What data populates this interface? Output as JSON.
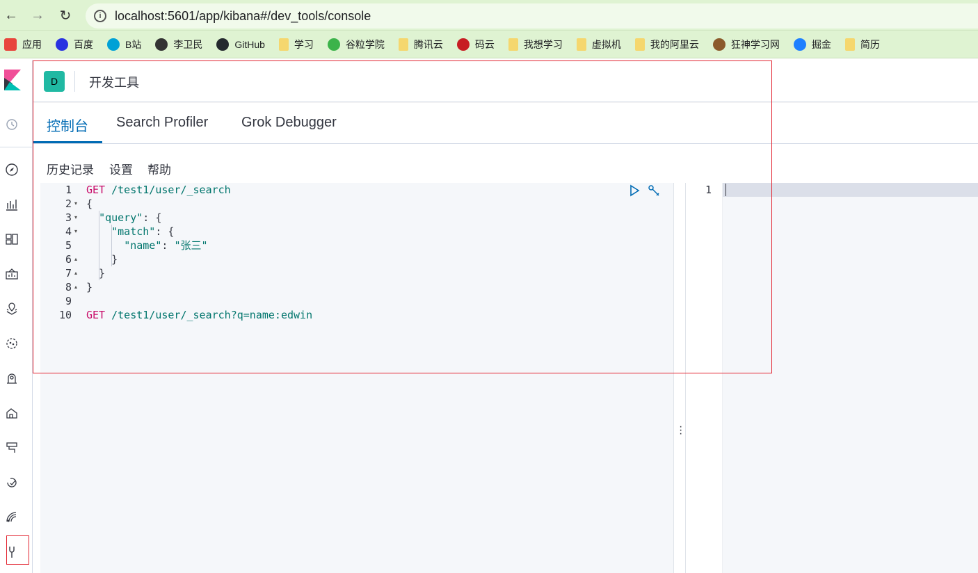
{
  "browser": {
    "url": "localhost:5601/app/kibana#/dev_tools/console",
    "bookmarks": [
      {
        "label": "应用",
        "icon": "apps-grid-icon",
        "color": "#e8453c"
      },
      {
        "label": "百度",
        "icon": "baidu-paw-icon",
        "color": "#2932e1"
      },
      {
        "label": "B站",
        "icon": "bilibili-tv-icon",
        "color": "#00a1d6"
      },
      {
        "label": "李卫民",
        "icon": "globe-icon",
        "color": "#333333"
      },
      {
        "label": "GitHub",
        "icon": "github-icon",
        "color": "#24292e"
      },
      {
        "label": "学习",
        "icon": "folder-icon",
        "color": "#f5d76e"
      },
      {
        "label": "谷粒学院",
        "icon": "gulixueyuan-icon",
        "color": "#3cb34a"
      },
      {
        "label": "腾讯云",
        "icon": "folder-icon",
        "color": "#f5d76e"
      },
      {
        "label": "码云",
        "icon": "gitee-icon",
        "color": "#c71d23"
      },
      {
        "label": "我想学习",
        "icon": "folder-icon",
        "color": "#f5d76e"
      },
      {
        "label": "虚拟机",
        "icon": "folder-icon",
        "color": "#f5d76e"
      },
      {
        "label": "我的阿里云",
        "icon": "folder-icon",
        "color": "#f5d76e"
      },
      {
        "label": "狂神学习网",
        "icon": "avatar-icon",
        "color": "#8b5a2b"
      },
      {
        "label": "掘金",
        "icon": "juejin-icon",
        "color": "#1e80ff"
      },
      {
        "label": "简历",
        "icon": "folder-icon",
        "color": "#f5d76e"
      }
    ]
  },
  "header": {
    "avatar_letter": "D",
    "title": "开发工具"
  },
  "tabs": [
    {
      "label": "控制台",
      "active": true
    },
    {
      "label": "Search Profiler",
      "active": false
    },
    {
      "label": "Grok Debugger",
      "active": false
    }
  ],
  "console_menu": {
    "history": "历史记录",
    "settings": "设置",
    "help": "帮助"
  },
  "editor": {
    "lines": [
      {
        "n": "1",
        "fold": "",
        "tokens": [
          [
            "kw",
            "GET"
          ],
          [
            "punc",
            " "
          ],
          [
            "path",
            "/test1/user/_search"
          ]
        ]
      },
      {
        "n": "2",
        "fold": "▾",
        "tokens": [
          [
            "punc",
            "{"
          ]
        ]
      },
      {
        "n": "3",
        "fold": "▾",
        "tokens": [
          [
            "punc",
            "  "
          ],
          [
            "key",
            "\"query\""
          ],
          [
            "punc",
            ": {"
          ]
        ]
      },
      {
        "n": "4",
        "fold": "▾",
        "tokens": [
          [
            "punc",
            "    "
          ],
          [
            "key",
            "\"match\""
          ],
          [
            "punc",
            ": {"
          ]
        ]
      },
      {
        "n": "5",
        "fold": "",
        "tokens": [
          [
            "punc",
            "      "
          ],
          [
            "key",
            "\"name\""
          ],
          [
            "punc",
            ": "
          ],
          [
            "str",
            "\"张三\""
          ]
        ]
      },
      {
        "n": "6",
        "fold": "▴",
        "tokens": [
          [
            "punc",
            "    }"
          ]
        ]
      },
      {
        "n": "7",
        "fold": "▴",
        "tokens": [
          [
            "punc",
            "  }"
          ]
        ]
      },
      {
        "n": "8",
        "fold": "▴",
        "tokens": [
          [
            "punc",
            "}"
          ]
        ]
      },
      {
        "n": "9",
        "fold": "",
        "tokens": []
      },
      {
        "n": "10",
        "fold": "",
        "tokens": [
          [
            "kw",
            "GET"
          ],
          [
            "punc",
            " "
          ],
          [
            "path",
            "/test1/user/_search?q=name:edwin"
          ]
        ]
      }
    ]
  },
  "output": {
    "line_number": "1"
  },
  "colors": {
    "accent": "#006bb4",
    "avatar": "#20b9a3",
    "keyword": "#c80a68",
    "string": "#00756c",
    "annotation": "#e2232f"
  }
}
